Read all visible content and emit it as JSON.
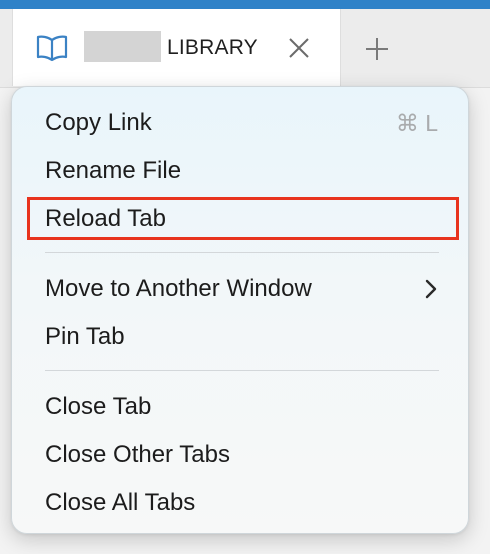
{
  "tab": {
    "title": "LIBRARY",
    "icon": "book-icon",
    "close_icon": "close-icon"
  },
  "new_tab_icon": "plus-icon",
  "menu": {
    "items": [
      {
        "label": "Copy Link",
        "shortcut": "⌘ L"
      },
      {
        "label": "Rename File"
      },
      {
        "label": "Reload Tab",
        "highlighted": true
      },
      {
        "label": "Move to Another Window",
        "submenu": true
      },
      {
        "label": "Pin Tab"
      },
      {
        "label": "Close Tab"
      },
      {
        "label": "Close Other Tabs"
      },
      {
        "label": "Close All Tabs"
      }
    ]
  },
  "colors": {
    "top_strip": "#2f82c8",
    "highlight_border": "#e8331e",
    "accent_icon": "#3b82c4"
  }
}
